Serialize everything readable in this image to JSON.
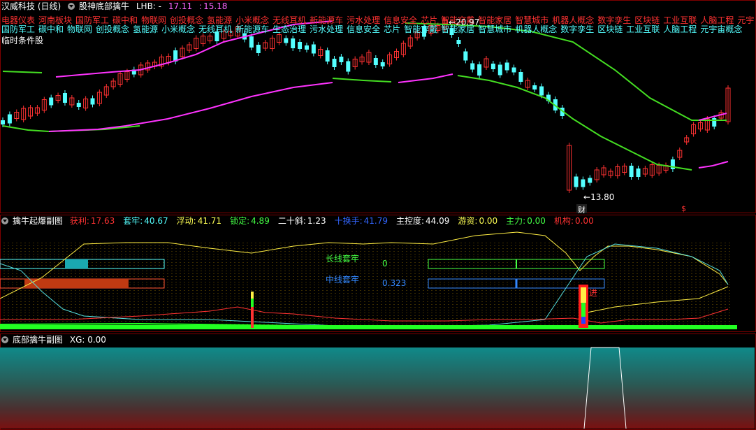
{
  "main": {
    "title": "汉威科技 (日线)",
    "indicator_name": "股神底部擒牛",
    "lhb_label": "LHB: -",
    "val1": "17.11",
    "val2": "15.18",
    "top_tags": [
      "电器仪表",
      "河南板块",
      "国防军工",
      "碳中和",
      "物联网",
      "创投概念",
      "氢能源",
      "小米概念",
      "无线耳机",
      "新能源车",
      "污水处理",
      "信息安全",
      "芯片",
      "智能穿戴",
      "智能家居",
      "智慧城市",
      "机器人概念",
      "数字孪生",
      "区块链",
      "工业互联",
      "人脑工程",
      "元宇"
    ],
    "second_tags": [
      "国防军工",
      "碳中和",
      "物联网",
      "创投概念",
      "氢能源",
      "小米概念",
      "无线耳机",
      "新能源车",
      "生态治理",
      "污水处理",
      "信息安全",
      "芯片",
      "智能穿戴",
      "智能家居",
      "智慧城市",
      "机器人概念",
      "数字孪生",
      "区块链",
      "工业互联",
      "人脑工程",
      "元宇宙概念"
    ],
    "temp_label": "临时条件股",
    "high_label": "20.97",
    "low_label": "13.80",
    "marker_cai": "财",
    "marker_s": "$",
    "colors": {
      "up": "#ff3232",
      "down": "#54ffff",
      "green_line": "#44dd22",
      "magenta_line": "#ff33ff"
    }
  },
  "sub1": {
    "title": "擒牛起爆副图",
    "fields": [
      {
        "label": "获利:",
        "value": "17.63",
        "color": "#ff3232"
      },
      {
        "label": "套牢:",
        "value": "40.67",
        "color": "#54ffff"
      },
      {
        "label": "浮动:",
        "value": "41.71",
        "color": "#ffff54"
      },
      {
        "label": "锁定:",
        "value": "4.89",
        "color": "#44ff44"
      },
      {
        "label": "二十斜:",
        "value": "1.23",
        "color": "#ffffff"
      },
      {
        "label": "十换手:",
        "value": "41.79",
        "color": "#3366ff"
      },
      {
        "label": "主控度:",
        "value": "44.09",
        "color": "#ffffff"
      },
      {
        "label": "游资:",
        "value": "0.00",
        "color": "#ffff54"
      },
      {
        "label": "主力:",
        "value": "0.00",
        "color": "#44ff44"
      },
      {
        "label": "机构:",
        "value": "0.00",
        "color": "#ff3232"
      }
    ],
    "long_label": "长线套牢",
    "long_value": "0",
    "mid_label": "中线套牢",
    "mid_value": "0.323",
    "jin_label": "进"
  },
  "sub2": {
    "title": "底部擒牛副图",
    "xg_label": "XG: 0.00"
  }
}
